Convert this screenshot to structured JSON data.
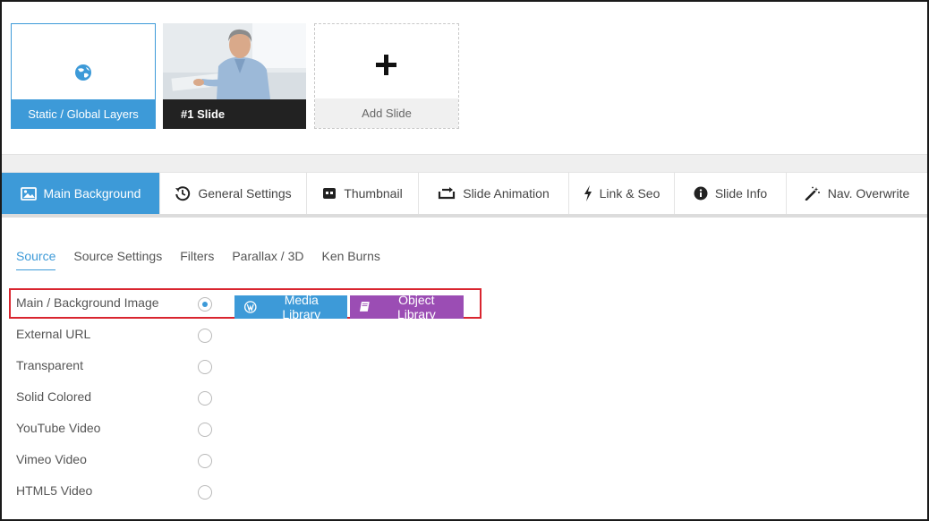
{
  "slides": {
    "static_label": "Static / Global Layers",
    "slide1_label": "#1 Slide",
    "add_label": "Add Slide"
  },
  "tabs": [
    {
      "label": "Main Background",
      "icon": "image-icon"
    },
    {
      "label": "General Settings",
      "icon": "history-icon"
    },
    {
      "label": "Thumbnail",
      "icon": "thumbnail-icon"
    },
    {
      "label": "Slide Animation",
      "icon": "loop-icon"
    },
    {
      "label": "Link & Seo",
      "icon": "bolt-icon"
    },
    {
      "label": "Slide Info",
      "icon": "info-icon"
    },
    {
      "label": "Nav. Overwrite",
      "icon": "magic-wand-icon"
    }
  ],
  "subtabs": [
    "Source",
    "Source Settings",
    "Filters",
    "Parallax / 3D",
    "Ken Burns"
  ],
  "source_options": [
    {
      "label": "Main / Background Image",
      "selected": true
    },
    {
      "label": "External URL",
      "selected": false
    },
    {
      "label": "Transparent",
      "selected": false
    },
    {
      "label": "Solid Colored",
      "selected": false
    },
    {
      "label": "YouTube Video",
      "selected": false
    },
    {
      "label": "Vimeo Video",
      "selected": false
    },
    {
      "label": "HTML5 Video",
      "selected": false
    }
  ],
  "buttons": {
    "media_library": "Media Library",
    "object_library": "Object Library"
  },
  "colors": {
    "accent": "#3d9ad8",
    "object_library": "#9b4db4",
    "highlight": "#d9252f",
    "slide_caption_dark": "#222222"
  }
}
